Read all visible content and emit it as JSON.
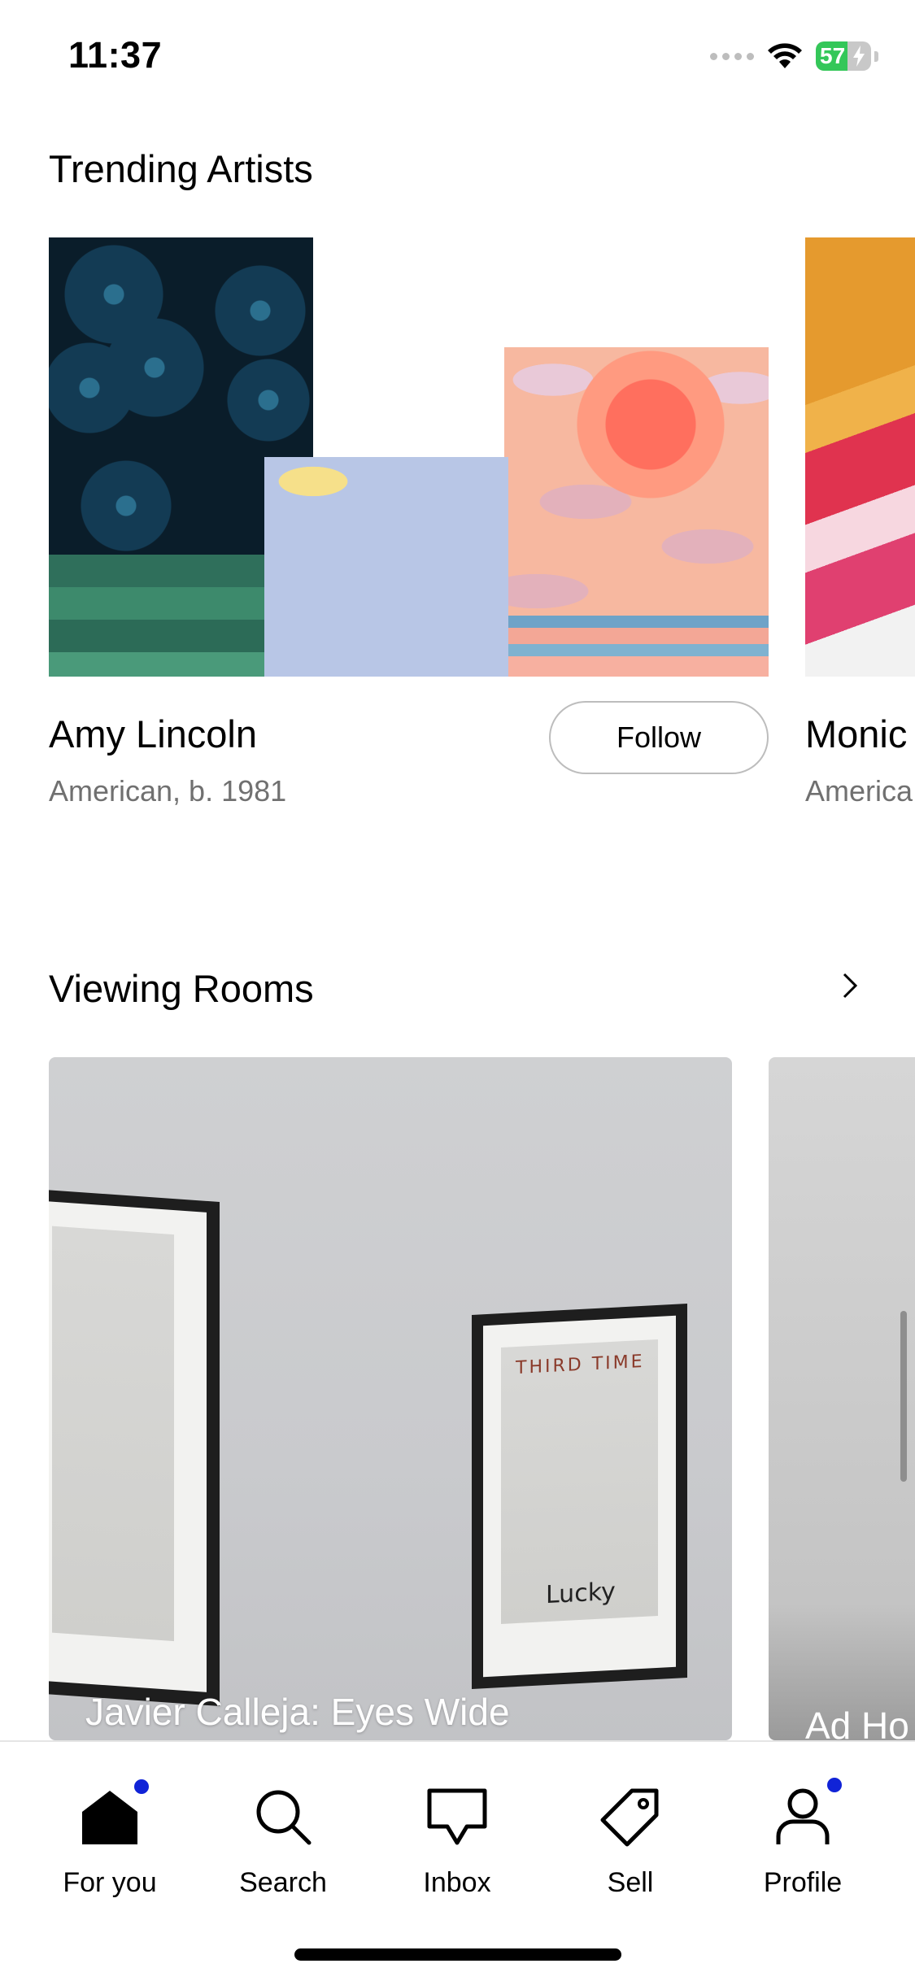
{
  "status_bar": {
    "time": "11:37",
    "battery": "57",
    "battery_level": 0.57
  },
  "trending_artists": {
    "title": "Trending Artists",
    "artists": [
      {
        "name": "Amy Lincoln",
        "meta": "American, b. 1981",
        "follow_label": "Follow"
      },
      {
        "name": "Monic",
        "meta": "America"
      }
    ]
  },
  "viewing_rooms": {
    "title": "Viewing Rooms",
    "rooms": [
      {
        "title": "Javier Calleja: Eyes Wide",
        "print_text_top": "THIRD TIME",
        "print_text_bottom": "Lucky"
      },
      {
        "title": "Ad Ho"
      }
    ]
  },
  "tab_bar": {
    "tabs": [
      {
        "label": "For you",
        "icon": "home-icon",
        "active": true,
        "badge": true
      },
      {
        "label": "Search",
        "icon": "search-icon"
      },
      {
        "label": "Inbox",
        "icon": "inbox-icon"
      },
      {
        "label": "Sell",
        "icon": "tag-icon"
      },
      {
        "label": "Profile",
        "icon": "profile-icon",
        "badge": true
      }
    ],
    "badge_color": "#1023d7"
  }
}
